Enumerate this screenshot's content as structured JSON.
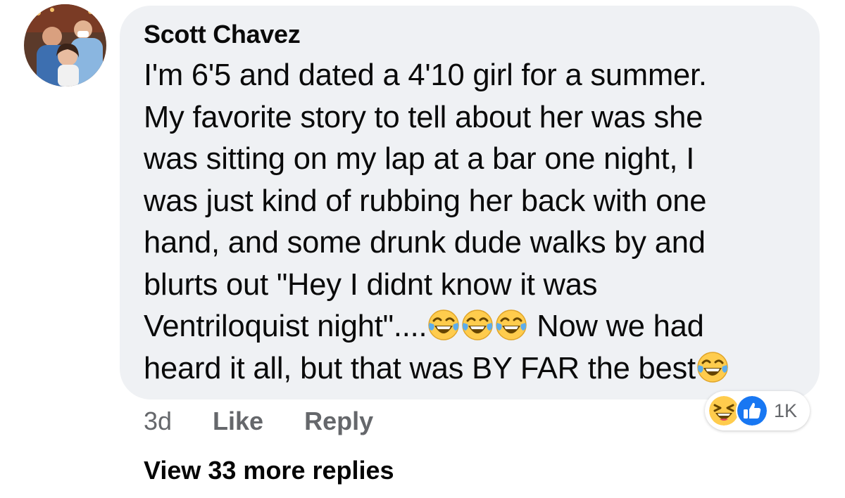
{
  "comment": {
    "author": "Scott Chavez",
    "text_lines": [
      "I'm 6'5 and dated a 4'10 girl for a summer.",
      "My favorite story to tell about her was she",
      "was sitting on my lap at a bar one night, I",
      "was just kind of rubbing her back with one",
      "hand, and some drunk dude walks by and",
      "blurts out \"Hey I didnt know it was",
      "Ventriloquist night\"....",
      " Now we had",
      "heard it all, but that was BY FAR the best"
    ],
    "emoji_icon": "face-with-tears-of-joy-icon",
    "timestamp": "3d",
    "like_label": "Like",
    "reply_label": "Reply",
    "reactions": {
      "icons": [
        "laughing-face-icon",
        "thumbs-up-icon"
      ],
      "count": "1K"
    },
    "view_more_label": "View 33 more replies"
  },
  "colors": {
    "bubble": "#eff1f4",
    "secondary_text": "#65676b",
    "like_blue": "#1877f2",
    "emoji_yellow": "#ffcc4d"
  }
}
